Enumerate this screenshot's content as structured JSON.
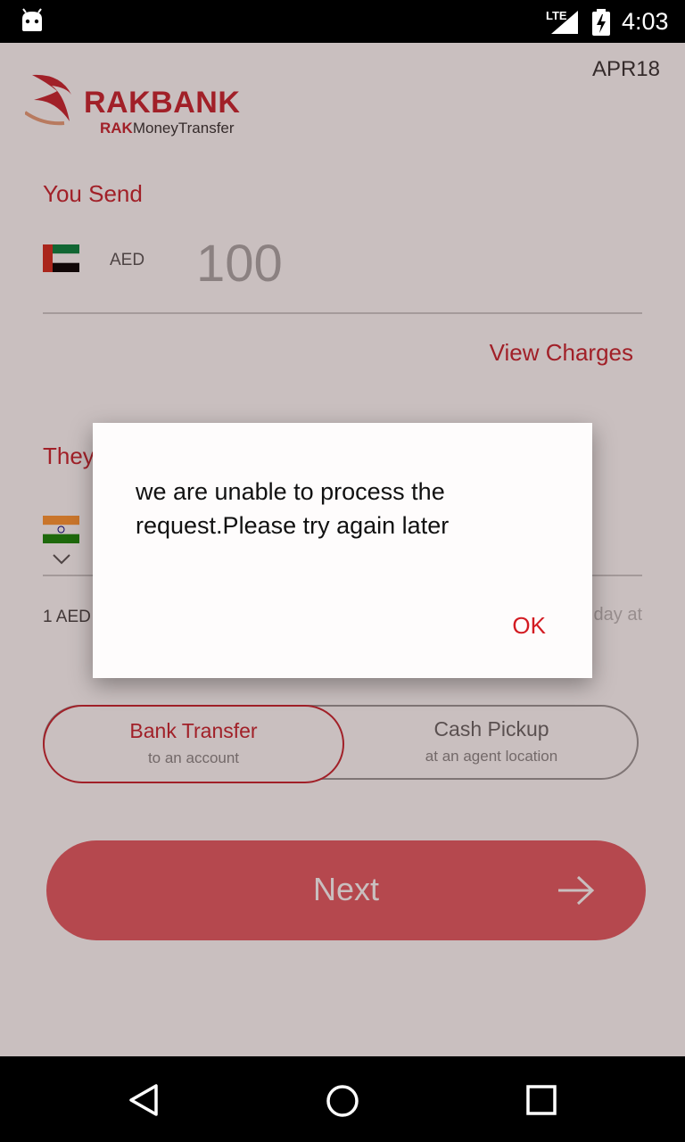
{
  "status_bar": {
    "network": "LTE",
    "time": "4:03"
  },
  "header": {
    "brand": "RAKBANK",
    "subtitle_bold": "RAK",
    "subtitle": "MoneyTransfer",
    "version": "APR18"
  },
  "send": {
    "label": "You Send",
    "currency": "AED",
    "amount": "100",
    "view_charges": "View Charges"
  },
  "receive": {
    "label": "They",
    "rate_text": "1 AED",
    "rate_right": "day at"
  },
  "options": {
    "bank_title": "Bank Transfer",
    "bank_sub": "to an account",
    "cash_title": "Cash Pickup",
    "cash_sub": "at an agent location"
  },
  "next_label": "Next",
  "dialog": {
    "message": "we are unable to process the request.Please try again later",
    "ok": "OK"
  },
  "colors": {
    "accent": "#c8232e",
    "button": "#e35a63"
  }
}
